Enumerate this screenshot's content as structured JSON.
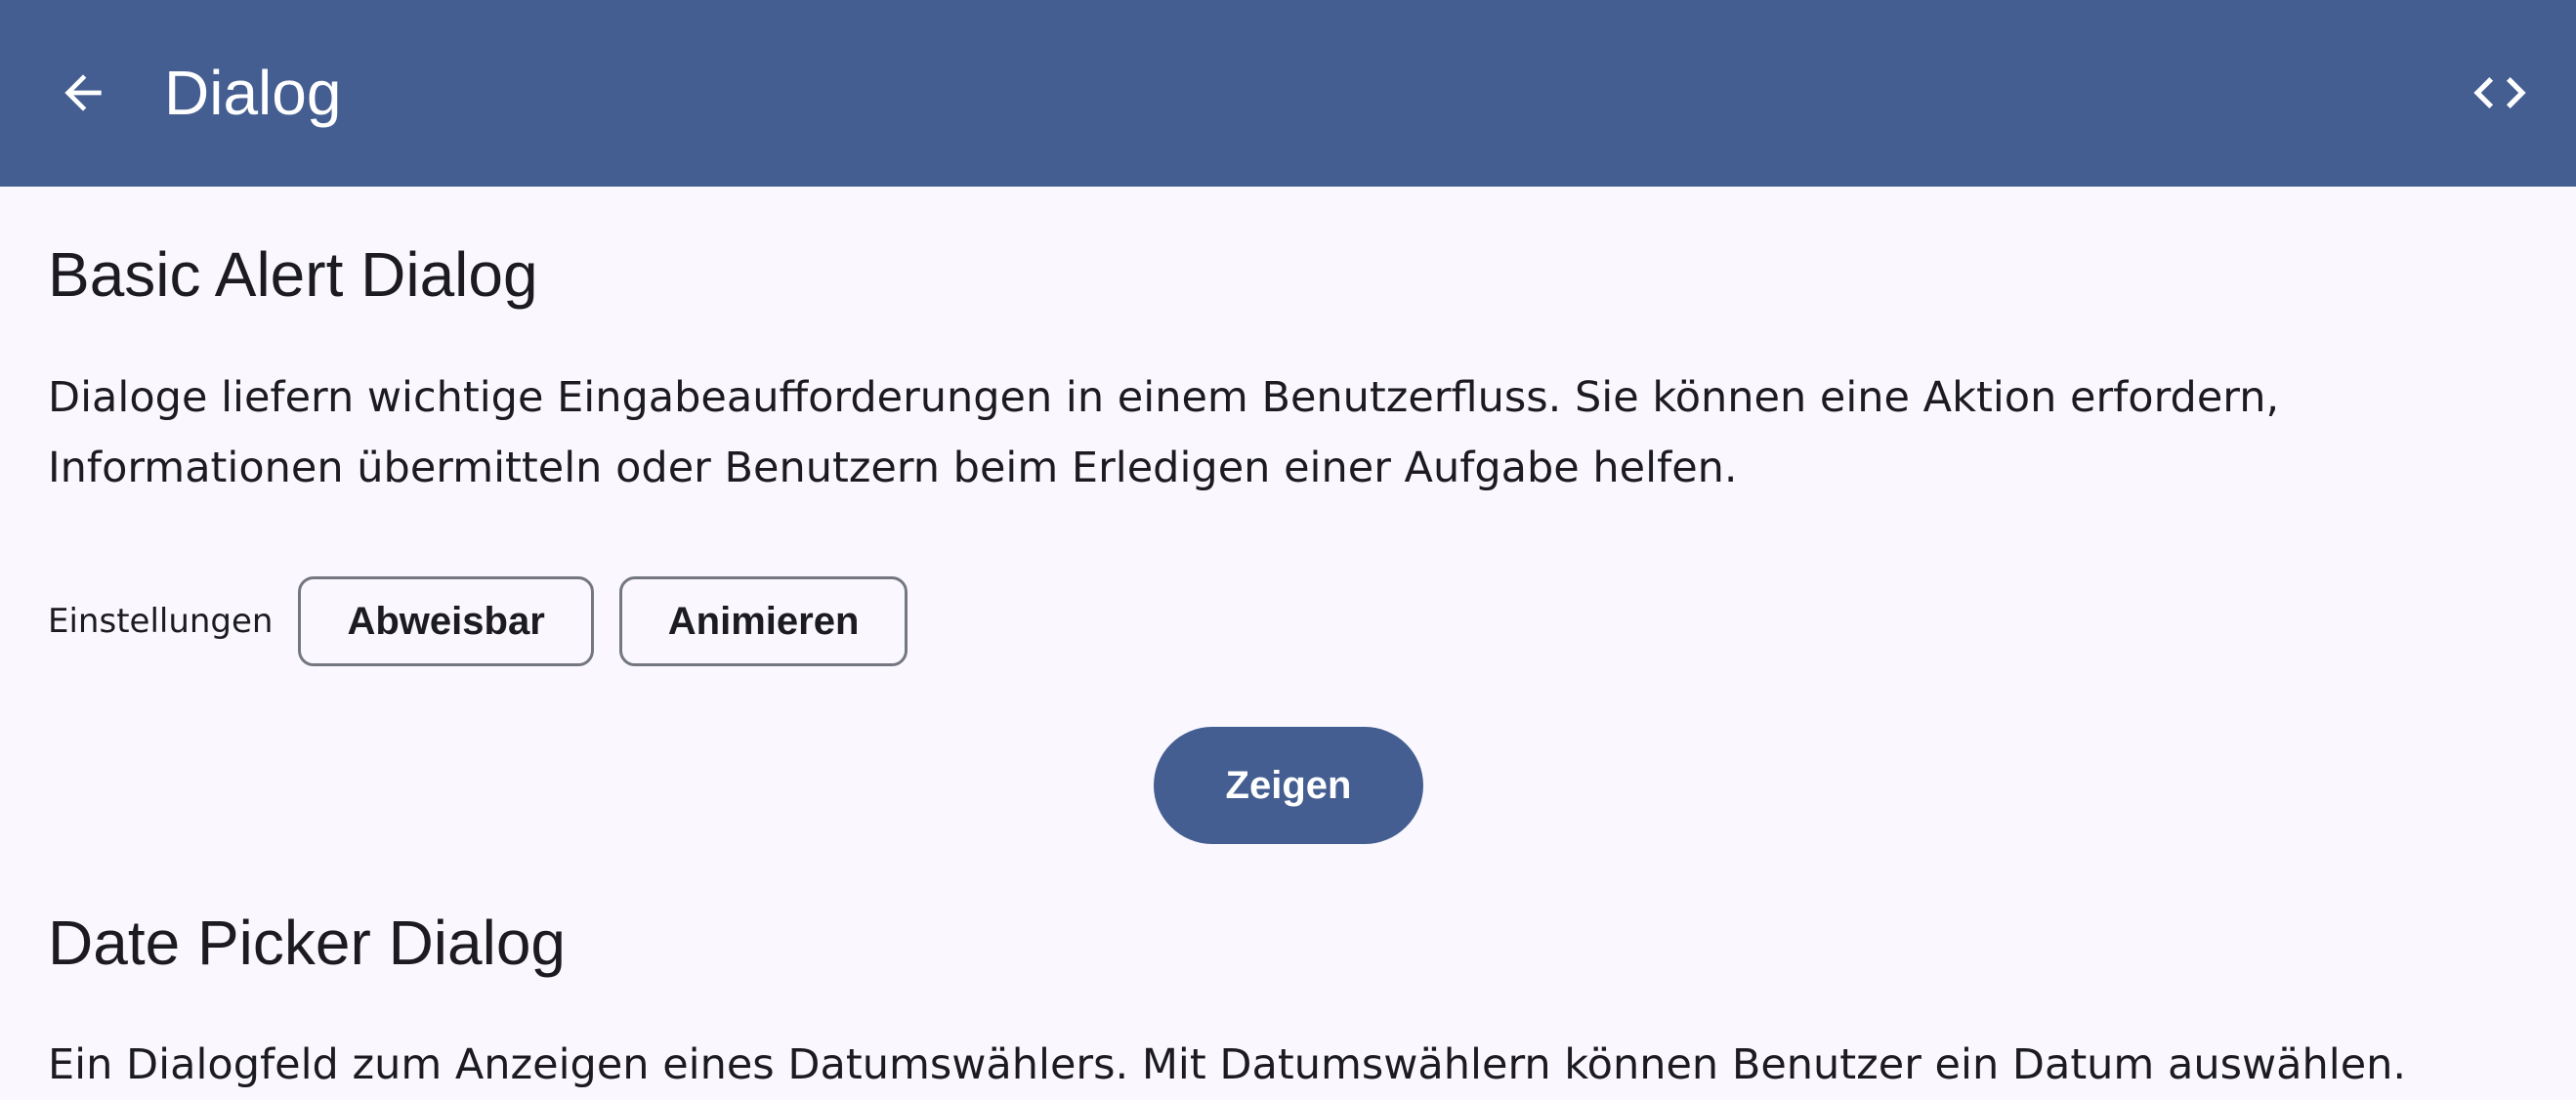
{
  "app_bar": {
    "title": "Dialog",
    "back_icon": "arrow-back-icon",
    "code_icon": "code-icon",
    "color": "#445E91"
  },
  "sections": [
    {
      "title": "Basic Alert Dialog",
      "description": "Dialoge liefern wichtige Eingabeaufforderungen in einem Benutzerfluss. Sie können eine Aktion erfordern, Informationen übermitteln oder Benutzern beim Erledigen einer Aufgabe helfen.",
      "settings_label": "Einstellungen",
      "chips": [
        "Abweisbar",
        "Animieren"
      ],
      "show_button": "Zeigen"
    },
    {
      "title": "Date Picker Dialog",
      "description": "Ein Dialogfeld zum Anzeigen eines Datumswählers. Mit Datumswählern können Benutzer ein Datum auswählen."
    }
  ],
  "colors": {
    "background": "#FAF8FE",
    "primary": "#445E91",
    "on_surface": "#1B1B21",
    "outline": "#74777F"
  }
}
